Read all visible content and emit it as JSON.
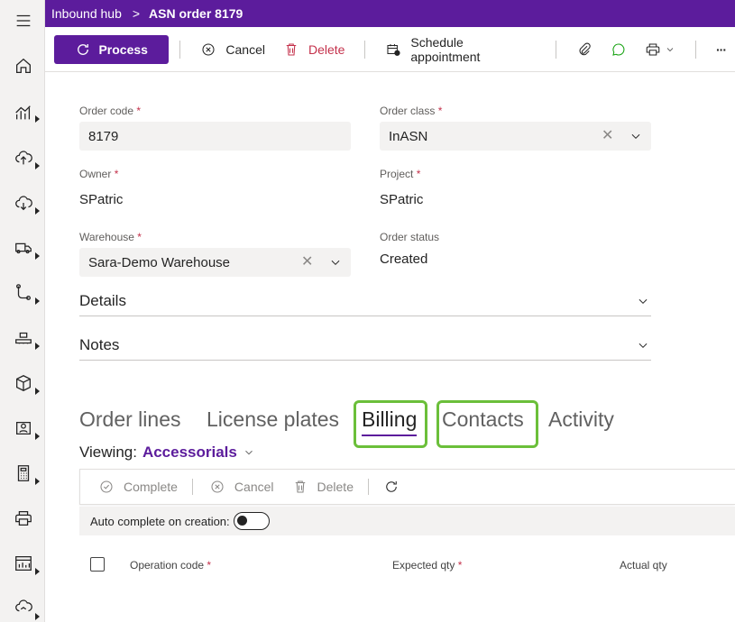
{
  "breadcrumb": {
    "root": "Inbound hub",
    "separator": ">",
    "current": "ASN order 8179"
  },
  "toolbar": {
    "process": "Process",
    "cancel": "Cancel",
    "delete": "Delete",
    "schedule": "Schedule appointment",
    "more": "···"
  },
  "form": {
    "order_code": {
      "label": "Order code",
      "value": "8179"
    },
    "order_class": {
      "label": "Order class",
      "value": "InASN"
    },
    "owner": {
      "label": "Owner",
      "value": "SPatric"
    },
    "project": {
      "label": "Project",
      "value": "SPatric"
    },
    "warehouse": {
      "label": "Warehouse",
      "value": "Sara-Demo Warehouse"
    },
    "order_status": {
      "label": "Order status",
      "value": "Created"
    },
    "required_mark": "*"
  },
  "sections": {
    "details": "Details",
    "notes": "Notes"
  },
  "tabs": [
    "Order lines",
    "License plates",
    "Billing",
    "Contacts",
    "Activity"
  ],
  "viewing": {
    "label": "Viewing:",
    "value": "Accessorials"
  },
  "subtoolbar": {
    "complete": "Complete",
    "cancel": "Cancel",
    "delete": "Delete"
  },
  "auto_complete": {
    "label": "Auto complete on creation:"
  },
  "grid": {
    "columns": [
      "Operation code",
      "Expected qty",
      "Actual qty"
    ]
  },
  "colors": {
    "brand": "#5c1c9c",
    "highlight": "#6bbf3a",
    "required": "#c4314b"
  }
}
